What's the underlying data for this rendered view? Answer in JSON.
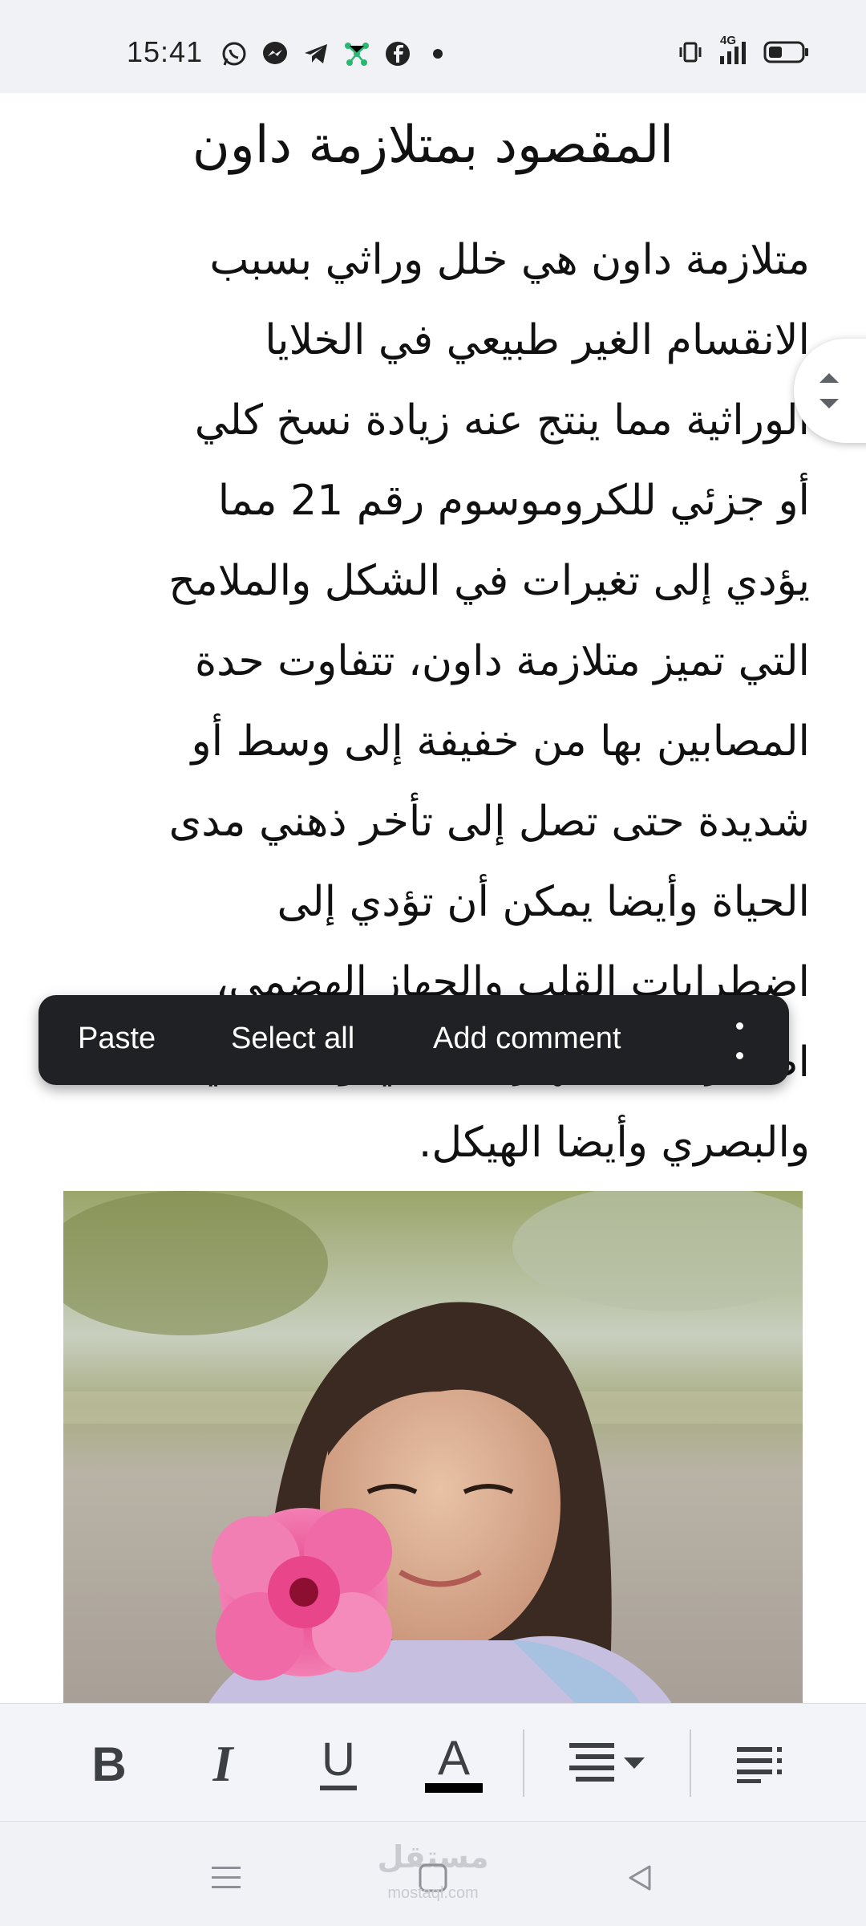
{
  "status_bar": {
    "time": "15:41",
    "notification_icons": [
      "whatsapp-icon",
      "messenger-icon",
      "telegram-icon",
      "network-app-icon",
      "facebook-icon",
      "more-dot-icon"
    ],
    "network_label": "4G",
    "right_icons": [
      "vibrate-icon",
      "signal-icon",
      "battery-icon"
    ]
  },
  "document": {
    "heading": "المقصود بمتلازمة داون",
    "body_lines": [
      "متلازمة داون هي خلل وراثي بسبب",
      "الانقسام الغير طبيعي في الخلايا",
      "الوراثية مما ينتج عنه زيادة نسخ كلي",
      "أو جزئي للكروموسوم رقم 21 مما",
      "يؤدي إلى تغيرات في الشكل والملامح",
      "التي تميز متلازمة داون، تتفاوت حدة",
      "المصابين بها  من خفيفة إلى وسط أو",
      "شديدة  حتى تصل إلى تأخر ذهني مدى",
      "الحياة وأيضا يمكن أن تؤدي إلى",
      "اضطرابات القلب والجهاز الهضمي،",
      "اضطرابات الجهاز العصبي والسمعي",
      "والبصري وأيضا الهيكل."
    ],
    "image_icon": "photo-girl-with-pink-flower"
  },
  "context_menu": {
    "paste": "Paste",
    "select_all": "Select all",
    "add_comment": "Add comment",
    "more_icon": "more-vertical-icon"
  },
  "toolbar": {
    "bold": "B",
    "italic": "I",
    "underline": "U",
    "text_color": "A",
    "text_color_value": "#000000",
    "align_icon": "align-dropdown-icon",
    "list_icon": "list-icon"
  },
  "navbar": {
    "watermark": "مستقل",
    "watermark_sub": "mostaql.com",
    "icons": [
      "menu-icon",
      "home-icon",
      "back-icon"
    ]
  },
  "colors": {
    "status_bg": "#f1f2f6",
    "menu_bg": "#202124",
    "toolbar_bg": "#f3f4f9",
    "text": "#111111"
  }
}
